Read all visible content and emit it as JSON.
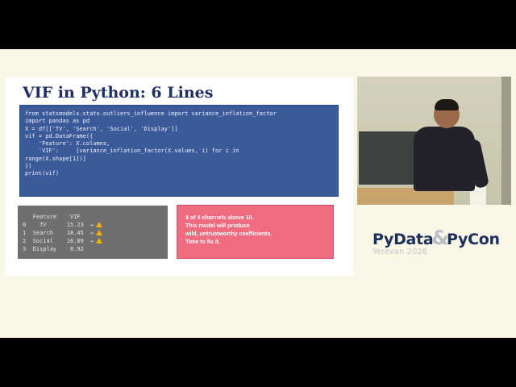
{
  "slide": {
    "title": "VIF in Python: 6 Lines",
    "code_lines": [
      "from statsmodels.stats.outliers_influence import variance_inflation_factor",
      "import pandas as pd",
      "",
      "X = df[['TV', 'Search', 'Social', 'Display']]",
      "",
      "vif = pd.DataFrame({",
      "    'Feature': X.columns,",
      "    'VIF':     [variance_inflation_factor(X.values, i) for i in",
      "range(X.shape[1])]",
      "})",
      "print(vif)"
    ],
    "output": {
      "header": "   Feature    VIF",
      "rows": [
        {
          "text": "0    TV      15.23  ←",
          "warn": true
        },
        {
          "text": "1  Search    18.45  ←",
          "warn": true
        },
        {
          "text": "2  Social    16.89  ←",
          "warn": true
        },
        {
          "text": "3  Display    8.92",
          "warn": false
        }
      ]
    },
    "callout_lines": [
      "3 of 4 channels above 10.",
      "This model will produce",
      "wild, untrustworthy coefficients.",
      "Time to fix it."
    ]
  },
  "logo": {
    "main_left": "PyData",
    "ampersand": "&",
    "main_right": "PyCon",
    "subtitle": "Yerevan 2026"
  },
  "colors": {
    "code_background": "#3b5a9a",
    "callout_background": "#ef6b80",
    "output_background": "#6f6f6f",
    "warning": "#f0b400",
    "title": "#1f2f63"
  },
  "icons": {
    "warning": "warning-icon"
  }
}
